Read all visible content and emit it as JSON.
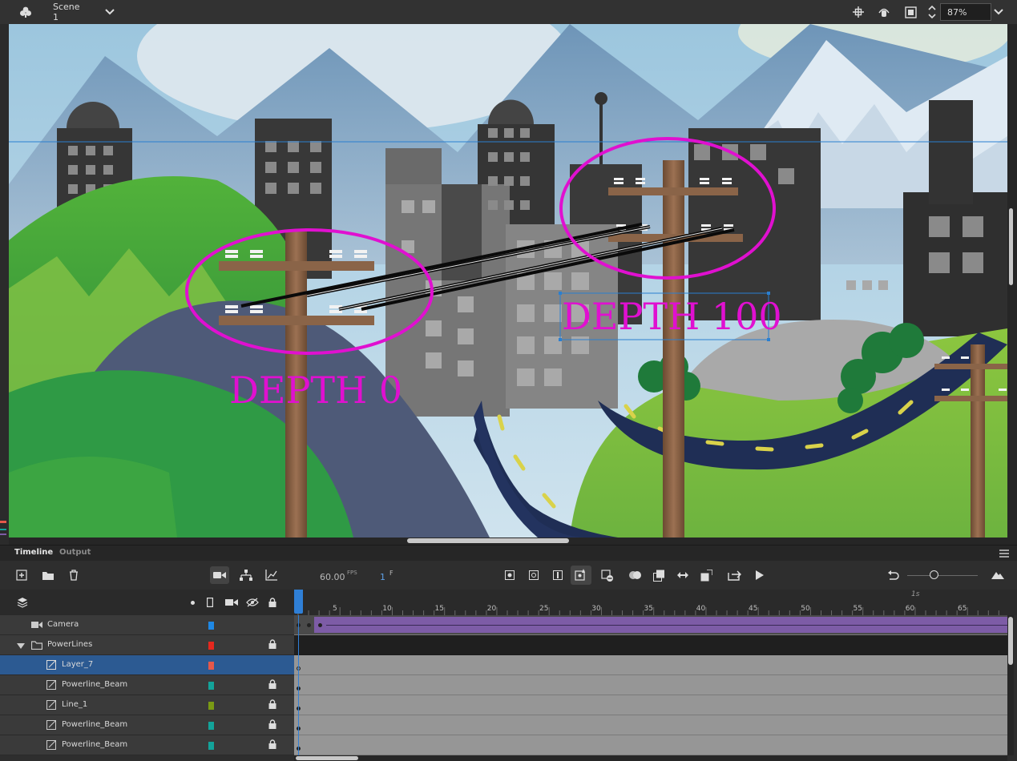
{
  "topbar": {
    "scene_label": "Scene 1",
    "zoom_value": "87%",
    "icons": [
      "scene-icon",
      "chevron-down-icon",
      "center-stage-icon",
      "rotate-hand-icon",
      "clip-canvas-icon",
      "zoom-stepper-icon",
      "zoom-dropdown-icon"
    ]
  },
  "stage": {
    "depth0_label": "DEPTH 0",
    "depth100_label": "DEPTH 100",
    "label_color": "#e010d0",
    "guide_color": "#2a7fd0"
  },
  "timeline": {
    "tab_timeline": "Timeline",
    "tab_output": "Output",
    "fps_value": "60.00",
    "fps_unit": "FPS",
    "frame_value": "1",
    "frame_unit": "F",
    "ruler_marker": "1s",
    "ruler_numbers": [
      "5",
      "10",
      "15",
      "20",
      "25",
      "30",
      "35",
      "40",
      "45",
      "50",
      "55",
      "60",
      "65"
    ],
    "accent": "#2c5a92",
    "camera_span_color": "#7d5ca6",
    "layers": [
      {
        "name": "Camera",
        "color": "#1e88e5",
        "locked": false,
        "type": "camera"
      },
      {
        "name": "PowerLines",
        "color": "#e5281e",
        "locked": true,
        "type": "folder"
      },
      {
        "name": "Layer_7",
        "color": "#e5584a",
        "locked": false,
        "type": "layer",
        "selected": true
      },
      {
        "name": "Powerline_Beam",
        "color": "#13a39a",
        "locked": true,
        "type": "layer"
      },
      {
        "name": "Line_1",
        "color": "#7a9a14",
        "locked": true,
        "type": "layer"
      },
      {
        "name": "Powerline_Beam",
        "color": "#13a39a",
        "locked": true,
        "type": "layer"
      },
      {
        "name": "Powerline_Beam",
        "color": "#13a39a",
        "locked": true,
        "type": "layer"
      }
    ]
  }
}
